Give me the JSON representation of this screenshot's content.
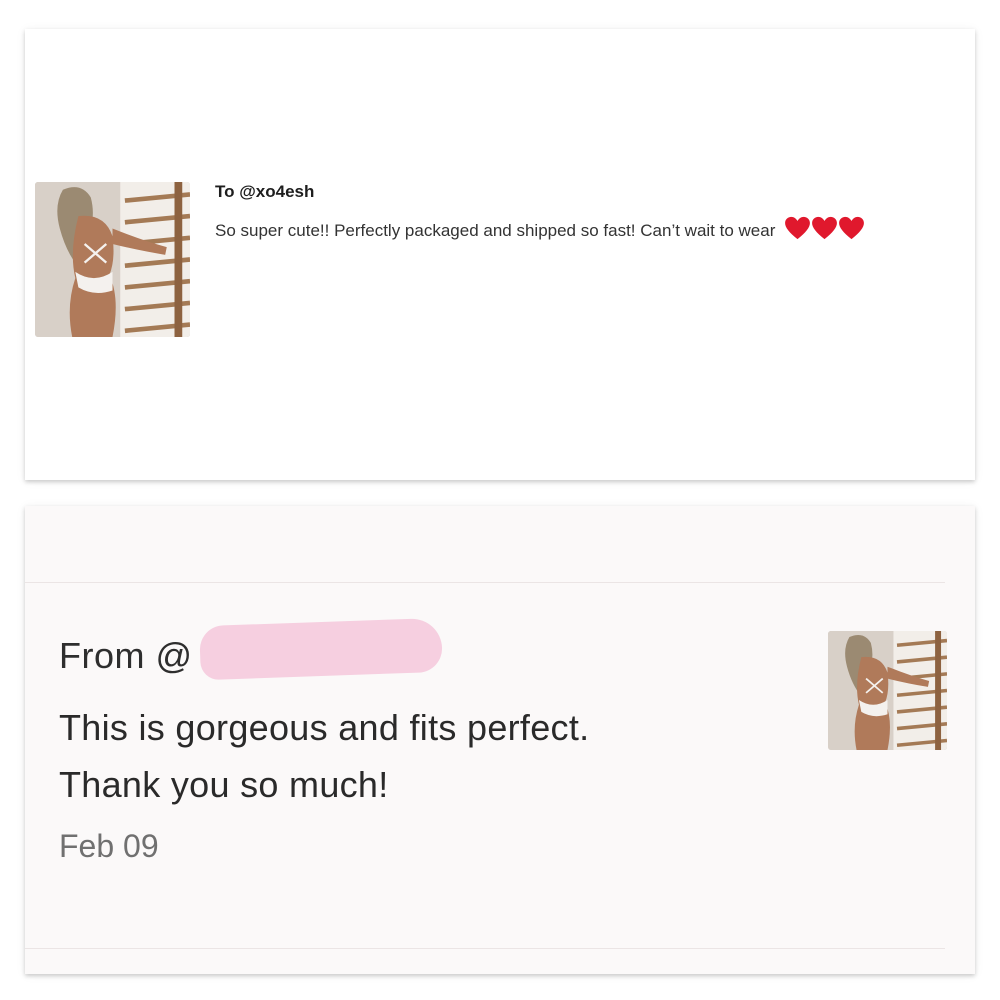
{
  "top_card": {
    "recipient": "To @xo4esh",
    "review_text": "So super cute!! Perfectly packaged and shipped so fast! Can’t wait to wear",
    "hearts": [
      "heart-icon",
      "heart-icon",
      "heart-icon"
    ],
    "heart_color": "#e0182d"
  },
  "bottom_card": {
    "sender_prefix": "From @",
    "review_line1": "This is gorgeous and fits perfect.",
    "review_line2": "Thank you so much!",
    "date": "Feb 09",
    "redaction_color": "#f6cfe0"
  }
}
